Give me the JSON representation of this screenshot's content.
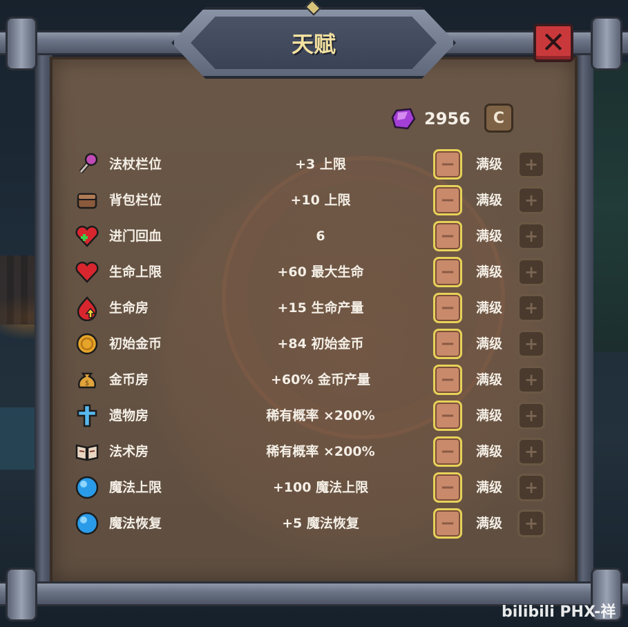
{
  "title": "天赋",
  "currency": {
    "amount": "2956",
    "icon": "purple-gem-icon",
    "reset_symbol": "C"
  },
  "close_symbol": "✕",
  "minus_symbol": "−",
  "plus_symbol": "+",
  "talents": [
    {
      "name": "法杖栏位",
      "effect": "+3 上限",
      "level": "满级",
      "icon": "wand-icon",
      "color": "#c04bb6"
    },
    {
      "name": "背包栏位",
      "effect": "+10 上限",
      "level": "满级",
      "icon": "backpack-icon",
      "color": "#8a5a3c"
    },
    {
      "name": "进门回血",
      "effect": "6",
      "level": "满级",
      "icon": "heart-heal-icon",
      "color": "#d8262e"
    },
    {
      "name": "生命上限",
      "effect": "+60 最大生命",
      "level": "满级",
      "icon": "heart-icon",
      "color": "#d8262e"
    },
    {
      "name": "生命房",
      "effect": "+15 生命产量",
      "level": "满级",
      "icon": "heart-up-icon",
      "color": "#d8262e"
    },
    {
      "name": "初始金币",
      "effect": "+84 初始金币",
      "level": "满级",
      "icon": "gold-coin-icon",
      "color": "#e5a52a"
    },
    {
      "name": "金币房",
      "effect": "+60% 金币产量",
      "level": "满级",
      "icon": "money-bag-icon",
      "color": "#e0a43a"
    },
    {
      "name": "遗物房",
      "effect": "稀有概率 ×200%",
      "level": "满级",
      "icon": "cross-relic-icon",
      "color": "#58b8ee"
    },
    {
      "name": "法术房",
      "effect": "稀有概率 ×200%",
      "level": "满级",
      "icon": "spellbook-icon",
      "color": "#e9d7c4"
    },
    {
      "name": "魔法上限",
      "effect": "+100 魔法上限",
      "level": "满级",
      "icon": "mana-orb-icon",
      "color": "#2a9be8"
    },
    {
      "name": "魔法恢复",
      "effect": "+5 魔法恢复",
      "level": "满级",
      "icon": "mana-orb-icon",
      "color": "#2a9be8"
    }
  ],
  "watermark": "bilibili PHX-祥"
}
